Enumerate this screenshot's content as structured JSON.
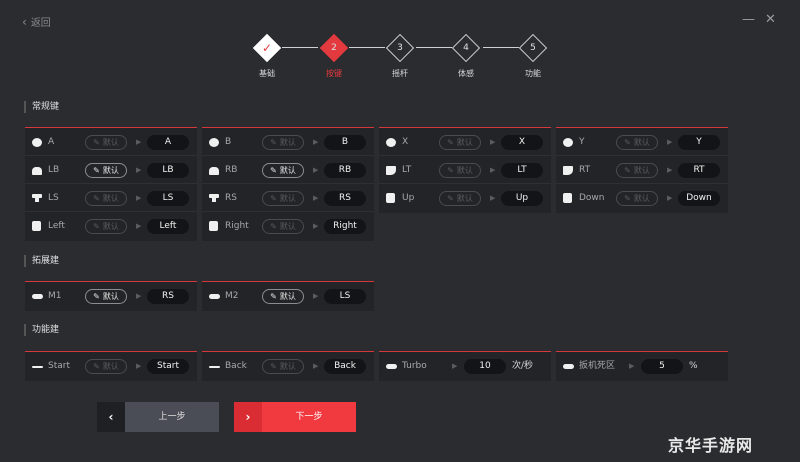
{
  "topbar": {
    "back_label": "返回",
    "minimize_glyph": "—",
    "close_glyph": "✕"
  },
  "stepper": {
    "steps": [
      {
        "label": "基础",
        "number": "✓",
        "state": "done"
      },
      {
        "label": "按键",
        "number": "2",
        "state": "active"
      },
      {
        "label": "摇杆",
        "number": "3",
        "state": "todo"
      },
      {
        "label": "体感",
        "number": "4",
        "state": "todo"
      },
      {
        "label": "功能",
        "number": "5",
        "state": "todo"
      }
    ]
  },
  "sections": {
    "regular": {
      "title": "常规键",
      "columns": [
        [
          {
            "name": "A",
            "icon": "circle",
            "default": "默认",
            "default_on": false,
            "value": "A"
          },
          {
            "name": "LB",
            "icon": "bumper",
            "default": "默认",
            "default_on": true,
            "value": "LB"
          },
          {
            "name": "LS",
            "icon": "stick",
            "default": "默认",
            "default_on": false,
            "value": "LS"
          },
          {
            "name": "Left",
            "icon": "dpad",
            "default": "默认",
            "default_on": false,
            "value": "Left"
          }
        ],
        [
          {
            "name": "B",
            "icon": "circle",
            "default": "默认",
            "default_on": false,
            "value": "B"
          },
          {
            "name": "RB",
            "icon": "bumper",
            "default": "默认",
            "default_on": true,
            "value": "RB"
          },
          {
            "name": "RS",
            "icon": "stick",
            "default": "默认",
            "default_on": false,
            "value": "RS"
          },
          {
            "name": "Right",
            "icon": "dpad",
            "default": "默认",
            "default_on": false,
            "value": "Right"
          }
        ],
        [
          {
            "name": "X",
            "icon": "circle",
            "default": "默认",
            "default_on": false,
            "value": "X"
          },
          {
            "name": "LT",
            "icon": "trigger",
            "default": "默认",
            "default_on": false,
            "value": "LT"
          },
          {
            "name": "Up",
            "icon": "dpad",
            "default": "默认",
            "default_on": false,
            "value": "Up"
          }
        ],
        [
          {
            "name": "Y",
            "icon": "circle",
            "default": "默认",
            "default_on": false,
            "value": "Y"
          },
          {
            "name": "RT",
            "icon": "trigger",
            "default": "默认",
            "default_on": false,
            "value": "RT"
          },
          {
            "name": "Down",
            "icon": "dpad",
            "default": "默认",
            "default_on": false,
            "value": "Down"
          }
        ]
      ]
    },
    "extended": {
      "title": "拓展建",
      "columns": [
        [
          {
            "name": "M1",
            "icon": "pill",
            "default": "默认",
            "default_on": true,
            "value": "RS"
          }
        ],
        [
          {
            "name": "M2",
            "icon": "pill",
            "default": "默认",
            "default_on": true,
            "value": "LS"
          }
        ]
      ]
    },
    "function": {
      "title": "功能建",
      "start": {
        "name": "Start",
        "default": "默认",
        "value": "Start"
      },
      "back": {
        "name": "Back",
        "default": "默认",
        "value": "Back"
      },
      "turbo": {
        "name": "Turbo",
        "value": "10",
        "unit": "次/秒"
      },
      "deadzone": {
        "name": "扳机死区",
        "value": "5",
        "unit": "%"
      }
    }
  },
  "buttons": {
    "prev_label": "上一步",
    "next_label": "下一步",
    "prev_glyph": "‹",
    "next_glyph": "›"
  },
  "watermark": "京华手游网",
  "colors": {
    "accent": "#e23a3e",
    "background": "#2b2c30",
    "panel": "#232428"
  }
}
